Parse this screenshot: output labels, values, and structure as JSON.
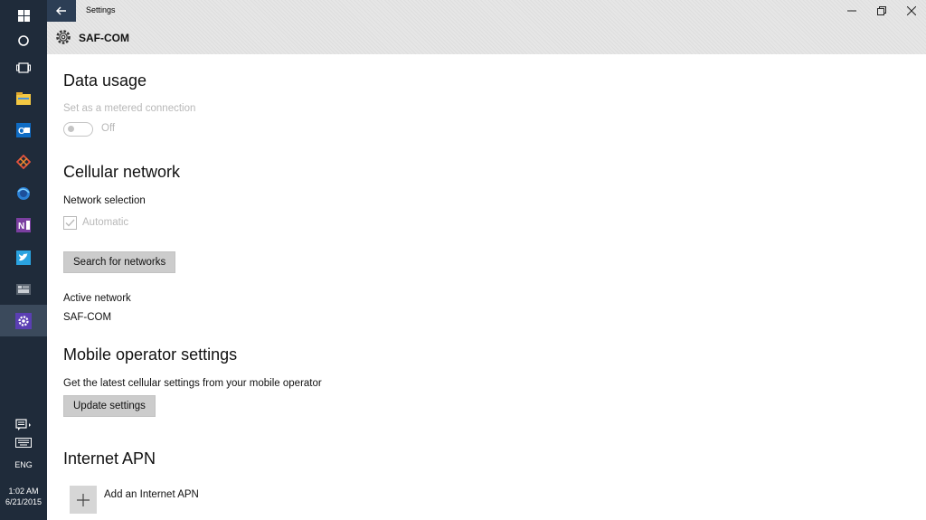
{
  "taskbar": {
    "items": [
      {
        "icon": "windows-start-icon"
      },
      {
        "icon": "search-circle-icon"
      },
      {
        "icon": "task-view-icon"
      },
      {
        "icon": "file-explorer-icon"
      },
      {
        "icon": "outlook-icon"
      },
      {
        "icon": "app-icon"
      },
      {
        "icon": "browser-icon"
      },
      {
        "icon": "onenote-icon"
      },
      {
        "icon": "twitter-icon"
      },
      {
        "icon": "photos-icon"
      },
      {
        "icon": "settings-gear-icon"
      }
    ],
    "language": "ENG",
    "time": "1:02 AM",
    "date": "6/21/2015"
  },
  "window": {
    "app_title": "Settings",
    "page_title": "SAF-COM"
  },
  "data_usage": {
    "heading": "Data usage",
    "metered_label": "Set as a metered connection",
    "toggle_state": "Off"
  },
  "cellular": {
    "heading": "Cellular network",
    "network_selection_label": "Network selection",
    "automatic_label": "Automatic",
    "search_button": "Search for networks",
    "active_network_label": "Active network",
    "active_network_value": "SAF-COM"
  },
  "operator": {
    "heading": "Mobile operator settings",
    "description": "Get the latest cellular settings from your mobile operator",
    "update_button": "Update settings"
  },
  "apn": {
    "heading": "Internet APN",
    "add_label": "Add an Internet APN"
  },
  "colors": {
    "taskbar": "#1f2b3a",
    "back_button": "#2c3e55",
    "titlebar": "#e6e6e6",
    "button": "#cccccc",
    "disabled_text": "#b8b8b8"
  }
}
